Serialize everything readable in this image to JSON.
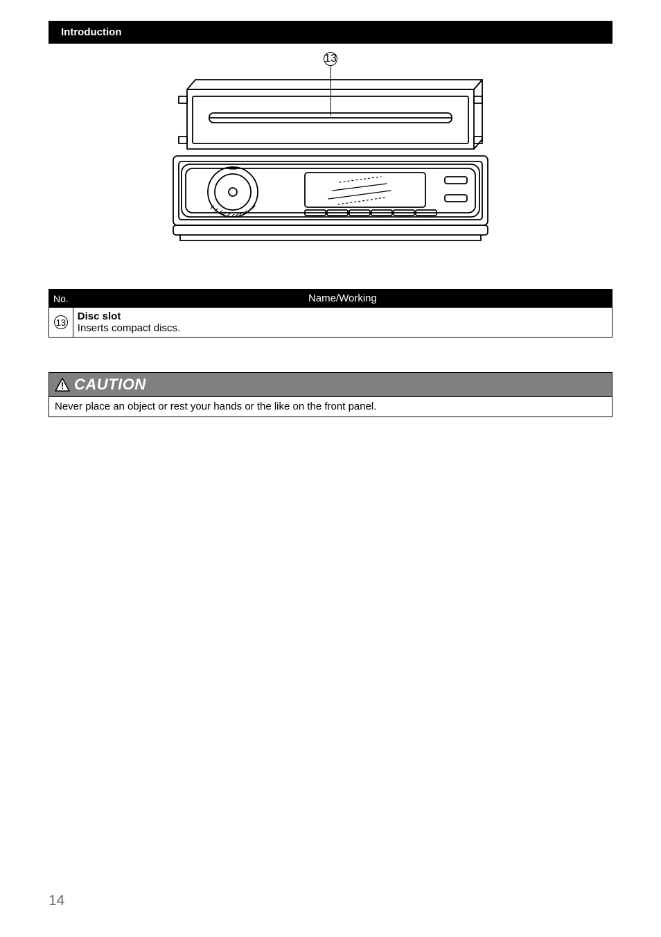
{
  "header": {
    "section_title": "Introduction"
  },
  "callout": {
    "number": "13"
  },
  "parts_table": {
    "columns": {
      "no": "No.",
      "name_working": "Name/Working"
    },
    "rows": [
      {
        "no": "13",
        "name": "Disc slot",
        "desc": "Inserts compact discs."
      }
    ]
  },
  "caution": {
    "label": "CAUTION",
    "text": "Never place an object or rest your hands or the like on the front panel."
  },
  "page_number": "14"
}
